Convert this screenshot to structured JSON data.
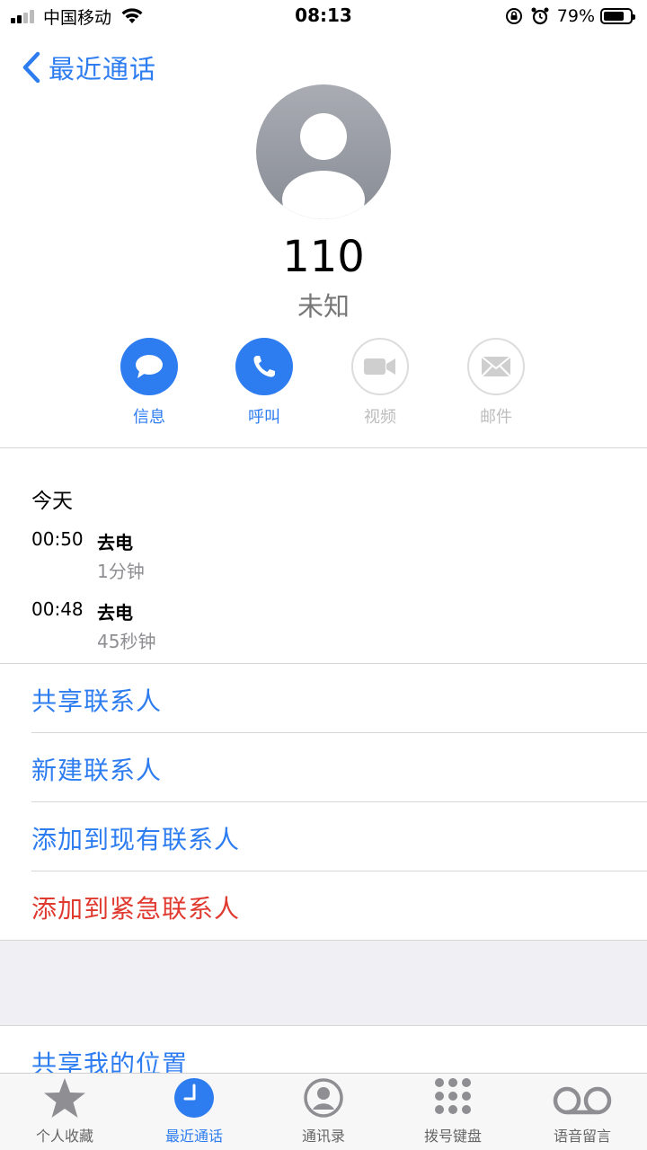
{
  "status_bar": {
    "carrier": "中国移动",
    "time": "08:13",
    "battery_percent": "79%",
    "battery_level": 0.79
  },
  "nav": {
    "back_label": "最近通话"
  },
  "contact": {
    "number": "110",
    "label": "未知"
  },
  "actions": [
    {
      "label": "信息",
      "enabled": true,
      "icon": "message-icon"
    },
    {
      "label": "呼叫",
      "enabled": true,
      "icon": "phone-icon"
    },
    {
      "label": "视频",
      "enabled": false,
      "icon": "video-icon"
    },
    {
      "label": "邮件",
      "enabled": false,
      "icon": "mail-icon"
    }
  ],
  "calls": {
    "section": "今天",
    "items": [
      {
        "time": "00:50",
        "direction": "去电",
        "duration": "1分钟"
      },
      {
        "time": "00:48",
        "direction": "去电",
        "duration": "45秒钟"
      }
    ]
  },
  "menu": [
    {
      "label": "共享联系人",
      "color": "#2d7cf0"
    },
    {
      "label": "新建联系人",
      "color": "#2d7cf0"
    },
    {
      "label": "添加到现有联系人",
      "color": "#2d7cf0"
    },
    {
      "label": "添加到紧急联系人",
      "color": "#e0392f"
    }
  ],
  "share_location": {
    "label": "共享我的位置"
  },
  "tabbar": {
    "tabs": [
      {
        "label": "个人收藏",
        "icon": "star-icon",
        "active": false
      },
      {
        "label": "最近通话",
        "icon": "clock-icon",
        "active": true
      },
      {
        "label": "通讯录",
        "icon": "contacts-icon",
        "active": false
      },
      {
        "label": "拨号键盘",
        "icon": "keypad-icon",
        "active": false
      },
      {
        "label": "语音留言",
        "icon": "voicemail-icon",
        "active": false
      }
    ]
  },
  "colors": {
    "accent": "#2d7cf0",
    "destructive": "#e0392f"
  }
}
